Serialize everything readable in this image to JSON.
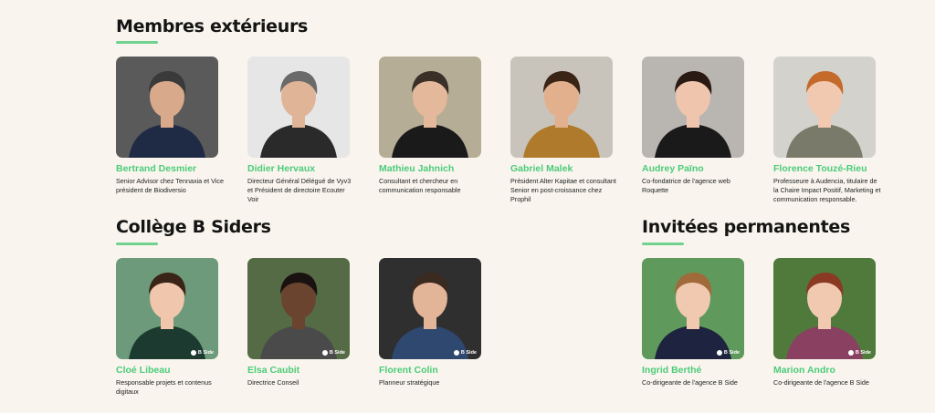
{
  "sections": {
    "external": {
      "title": "Membres extérieurs",
      "members": [
        {
          "name": "Bertrand Desmier",
          "role": "Senior Advisor chez Tennaxia et Vice président de Biodiversio",
          "bg": "#5a5a5a",
          "skin": "#d8a98a",
          "hair": "#3a3a3a",
          "shirt": "#1f2a44"
        },
        {
          "name": "Didier Hervaux",
          "role": "Directeur Général Délégué de Vyv3 et Président de directoire Ecouter Voir",
          "bg": "#e6e6e6",
          "skin": "#e0b497",
          "hair": "#6a6a6a",
          "shirt": "#2a2a2a"
        },
        {
          "name": "Mathieu Jahnich",
          "role": "Consultant et chercheur en communication responsable",
          "bg": "#b6ad96",
          "skin": "#e4b89a",
          "hair": "#3b3028",
          "shirt": "#1a1a1a"
        },
        {
          "name": "Gabriel Malek",
          "role": "Président Alter Kapitae et consultant Senior en post-croissance chez Prophil",
          "bg": "#c9c4bb",
          "skin": "#e2b08c",
          "hair": "#3a2416",
          "shirt": "#b07a2c"
        },
        {
          "name": "Audrey Païno",
          "role": "Co-fondatrice de l'agence web Roquette",
          "bg": "#b9b6b2",
          "skin": "#efc5ad",
          "hair": "#2a1a14",
          "shirt": "#1a1a1a"
        },
        {
          "name": "Florence Touzé-Rieu",
          "role": "Professeure à Audencia, titulaire de la Chaire Impact Positif, Marketing et communication responsable.",
          "bg": "#d4d2cc",
          "skin": "#f0c9b0",
          "hair": "#c46a2a",
          "shirt": "#7a7a6a"
        }
      ]
    },
    "college": {
      "title": "Collège B Siders",
      "members": [
        {
          "name": "Cloé Libeau",
          "role": "Responsable projets et contenus digitaux",
          "bg": "#6d9a7a",
          "skin": "#f0c6ac",
          "hair": "#3a2418",
          "shirt": "#1d3a30"
        },
        {
          "name": "Elsa Caubit",
          "role": "Directrice Conseil",
          "bg": "#556b46",
          "skin": "#6b4430",
          "hair": "#1a1210",
          "shirt": "#4a4a4a"
        },
        {
          "name": "Florent Colin",
          "role": "Planneur stratégique",
          "bg": "#2f2f2f",
          "skin": "#e2b498",
          "hair": "#3a2a20",
          "shirt": "#2e4870"
        }
      ]
    },
    "guests": {
      "title": "Invitées permanentes",
      "members": [
        {
          "name": "Ingrid Berthé",
          "role": "Co-dirigeante de l'agence B Side",
          "bg": "#5f9a5c",
          "skin": "#f0c9b0",
          "hair": "#a06a3a",
          "shirt": "#1e2340"
        },
        {
          "name": "Marion Andro",
          "role": "Co-dirigeante de l'agence B Side",
          "bg": "#4f7a3c",
          "skin": "#f0c9b0",
          "hair": "#8a3a22",
          "shirt": "#8a4060"
        }
      ]
    }
  },
  "badge_label": "B Side",
  "colors": {
    "accent": "#6fd28f",
    "name": "#4ccb78",
    "background": "#f9f5ee"
  }
}
